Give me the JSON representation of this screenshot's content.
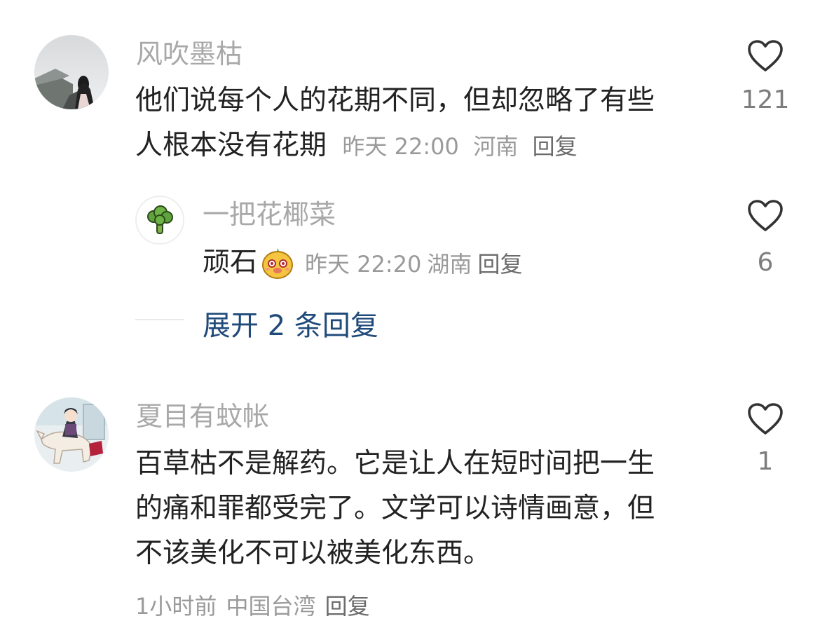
{
  "comments": [
    {
      "username": "风吹墨枯",
      "text_lines": [
        "他们说每个人的花期不同，但却忽略了有些",
        "人根本没有花期"
      ],
      "time": "昨天 22:00",
      "location": "河南",
      "reply_label": "回复",
      "likes": "121",
      "avatar_icon": "misty-landscape-girl-avatar"
    },
    {
      "username": "夏目有蚊帐",
      "text_lines": [
        "百草枯不是解药。它是让人在短时间把一生",
        "的痛和罪都受完了。文学可以诗情画意，但",
        "不该美化不可以被美化东西。"
      ],
      "time": "1小时前",
      "location": "中国台湾",
      "reply_label": "回复",
      "likes": "1",
      "avatar_icon": "anime-rider-horse-avatar"
    }
  ],
  "reply": {
    "username": "一把花椰菜",
    "text": "顽石",
    "emoji_icon": "smiling-bean-emoji",
    "time": "昨天 22:20",
    "location": "湖南",
    "reply_label": "回复",
    "likes": "6",
    "avatar_icon": "broccoli-icon"
  },
  "expand_label": "展开 2 条回复",
  "colors": {
    "username": "#a8a8a8",
    "text": "#222222",
    "meta": "#9a9a9a",
    "expand_link": "#1f4a7a"
  }
}
